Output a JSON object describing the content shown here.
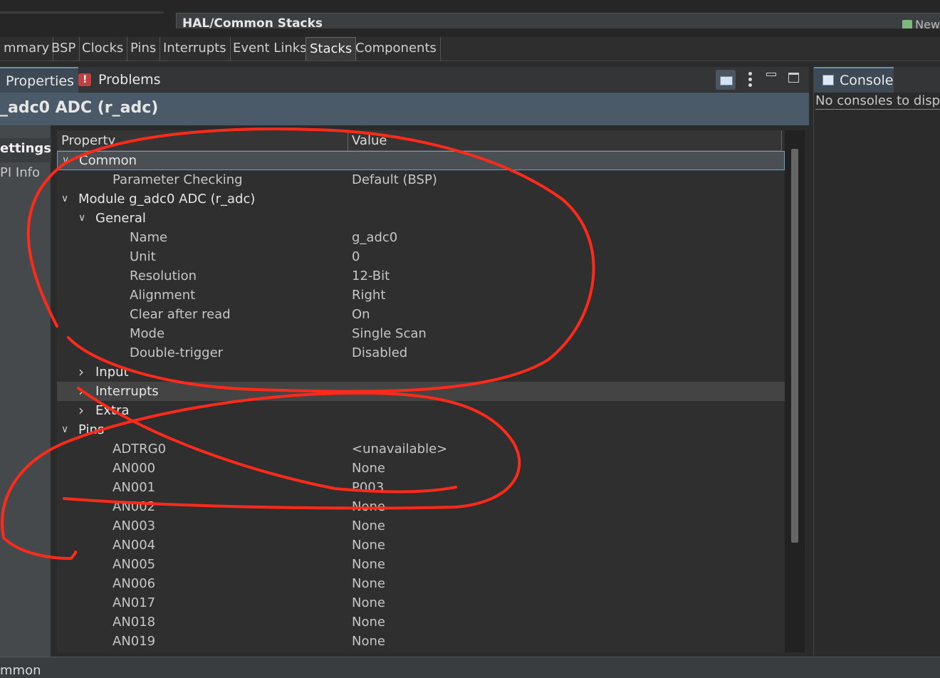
{
  "editor": {
    "title": "HAL/Common Stacks",
    "new_label": "New"
  },
  "config_tabs": [
    "mmary",
    "BSP",
    "Clocks",
    "Pins",
    "Interrupts",
    "Event Links",
    "Stacks",
    "Components"
  ],
  "active_config_tab": "Stacks",
  "views": {
    "properties": "Properties",
    "problems": "Problems"
  },
  "properties": {
    "header": "_adc0 ADC (r_adc)",
    "sidebar": [
      "ettings",
      "PI Info"
    ],
    "columns": {
      "property": "Property",
      "value": "Value"
    },
    "rows": [
      {
        "label": "Common",
        "value": "",
        "level": 0,
        "expander": "open"
      },
      {
        "label": "Parameter Checking",
        "value": "Default (BSP)",
        "level": 2,
        "expander": "none"
      },
      {
        "label": "Module g_adc0 ADC (r_adc)",
        "value": "",
        "level": 0,
        "expander": "open"
      },
      {
        "label": "General",
        "value": "",
        "level": 1,
        "expander": "open"
      },
      {
        "label": "Name",
        "value": "g_adc0",
        "level": 3,
        "expander": "none"
      },
      {
        "label": "Unit",
        "value": "0",
        "level": 3,
        "expander": "none"
      },
      {
        "label": "Resolution",
        "value": "12-Bit",
        "level": 3,
        "expander": "none"
      },
      {
        "label": "Alignment",
        "value": "Right",
        "level": 3,
        "expander": "none"
      },
      {
        "label": "Clear after read",
        "value": "On",
        "level": 3,
        "expander": "none"
      },
      {
        "label": "Mode",
        "value": "Single Scan",
        "level": 3,
        "expander": "none"
      },
      {
        "label": "Double-trigger",
        "value": "Disabled",
        "level": 3,
        "expander": "none"
      },
      {
        "label": "Input",
        "value": "",
        "level": 1,
        "expander": "closed"
      },
      {
        "label": "Interrupts",
        "value": "",
        "level": 1,
        "expander": "closed"
      },
      {
        "label": "Extra",
        "value": "",
        "level": 1,
        "expander": "closed"
      },
      {
        "label": "Pins",
        "value": "",
        "level": 0,
        "expander": "open"
      },
      {
        "label": "ADTRG0",
        "value": "<unavailable>",
        "level": 2,
        "expander": "none"
      },
      {
        "label": "AN000",
        "value": "None",
        "level": 2,
        "expander": "none"
      },
      {
        "label": "AN001",
        "value": "P003",
        "level": 2,
        "expander": "none"
      },
      {
        "label": "AN002",
        "value": "None",
        "level": 2,
        "expander": "none"
      },
      {
        "label": "AN003",
        "value": "None",
        "level": 2,
        "expander": "none"
      },
      {
        "label": "AN004",
        "value": "None",
        "level": 2,
        "expander": "none"
      },
      {
        "label": "AN005",
        "value": "None",
        "level": 2,
        "expander": "none"
      },
      {
        "label": "AN006",
        "value": "None",
        "level": 2,
        "expander": "none"
      },
      {
        "label": "AN017",
        "value": "None",
        "level": 2,
        "expander": "none"
      },
      {
        "label": "AN018",
        "value": "None",
        "level": 2,
        "expander": "none"
      },
      {
        "label": "AN019",
        "value": "None",
        "level": 2,
        "expander": "none"
      }
    ],
    "selected_row": "Common",
    "hover_row": "Interrupts"
  },
  "console": {
    "tab": "Console",
    "message": "No consoles to display"
  },
  "status": "mmon",
  "annotation_color": "#ff2a1a"
}
